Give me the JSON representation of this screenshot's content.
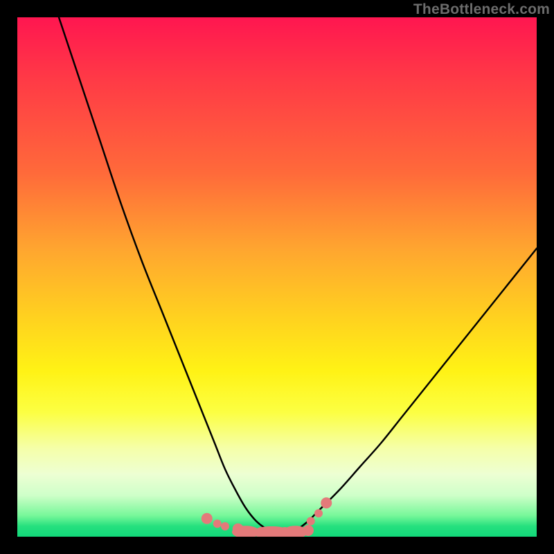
{
  "watermark": "TheBottleneck.com",
  "chart_data": {
    "type": "line",
    "title": "",
    "xlabel": "",
    "ylabel": "",
    "xlim": [
      0,
      100
    ],
    "ylim": [
      0,
      100
    ],
    "series": [
      {
        "name": "bottleneck-curve",
        "x": [
          8,
          12,
          16,
          20,
          24,
          28,
          32,
          36,
          38,
          40,
          42,
          44,
          46,
          48,
          50,
          52,
          54,
          56,
          58,
          62,
          66,
          70,
          74,
          78,
          82,
          86,
          90,
          94,
          98,
          100
        ],
        "y": [
          100,
          88,
          76,
          64,
          53,
          43,
          33,
          23,
          18,
          13,
          9,
          5.5,
          3,
          1.5,
          0.8,
          0.8,
          1.5,
          3,
          5,
          9,
          13.5,
          18,
          23,
          28,
          33,
          38,
          43,
          48,
          53,
          55.5
        ]
      }
    ],
    "markers": {
      "name": "highlight-points",
      "x": [
        36.5,
        38.5,
        40,
        42.5,
        44,
        45.5,
        47,
        48.5,
        50,
        51.5,
        53,
        54.5,
        56,
        56.5,
        58,
        59.5
      ],
      "y": [
        3.5,
        2.5,
        2,
        1.5,
        1,
        0.8,
        0.8,
        0.8,
        0.8,
        0.8,
        0.8,
        1,
        1.2,
        3,
        4.5,
        6.5
      ]
    },
    "colors": {
      "curve": "#000000",
      "markers": "#e37a7a",
      "gradient_top": "#ff1650",
      "gradient_bottom": "#12d87a"
    }
  }
}
